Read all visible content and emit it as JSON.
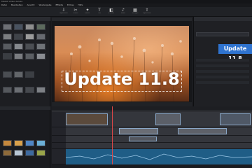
{
  "app": {
    "title": "MAGIX Video deluxe",
    "menu": [
      "Datei",
      "Bearbeiten",
      "Ansicht",
      "Wiedergabe",
      "Effekte",
      "Extras",
      "Hilfe"
    ]
  },
  "toolbar": {
    "buttons": [
      {
        "icon": "import-icon",
        "label": "Importieren"
      },
      {
        "icon": "cut-icon",
        "label": "Schnitt"
      },
      {
        "icon": "fx-icon",
        "label": "Effekte"
      },
      {
        "icon": "text-icon",
        "label": "Titel"
      },
      {
        "icon": "transition-icon",
        "label": "Blenden"
      },
      {
        "icon": "audio-icon",
        "label": "Audio"
      },
      {
        "icon": "templates-icon",
        "label": "Vorlagen"
      },
      {
        "icon": "export-icon",
        "label": "Exportieren"
      }
    ]
  },
  "preview": {
    "title_text": "Update 11.8"
  },
  "properties": {
    "badge": "Update 11.8"
  },
  "colors": {
    "accent": "#2f73cf",
    "playhead": "#e04848",
    "audio_track": "#1f5d86"
  }
}
